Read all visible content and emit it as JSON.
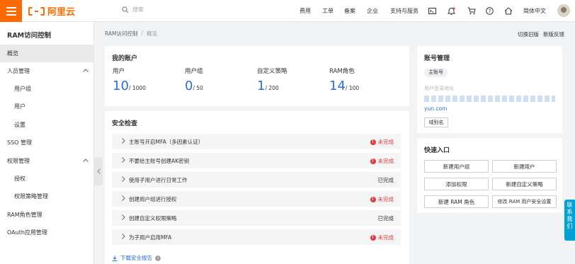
{
  "topbar": {
    "logo_text": "阿里云",
    "search_placeholder": "搜索",
    "nav": [
      "费用",
      "工单",
      "备案",
      "企业",
      "支持与服务"
    ],
    "lang": "简体中文"
  },
  "sidebar": {
    "title": "RAM访问控制",
    "items": [
      {
        "label": "概览"
      },
      {
        "label": "人员管理"
      },
      {
        "label": "用户组"
      },
      {
        "label": "用户"
      },
      {
        "label": "设置"
      },
      {
        "label": "SSO 管理"
      },
      {
        "label": "权限管理"
      },
      {
        "label": "授权"
      },
      {
        "label": "权限策略管理"
      },
      {
        "label": "RAM角色管理"
      },
      {
        "label": "OAuth应用管理"
      }
    ]
  },
  "breadcrumb": {
    "root": "RAM访问控制",
    "sep": "/",
    "current": "概览"
  },
  "header_links": {
    "old_version": "切换旧版",
    "feedback": "新版反馈"
  },
  "account": {
    "title": "我的账户",
    "stats": [
      {
        "label": "用户",
        "value": "10",
        "limit": "/ 1000"
      },
      {
        "label": "用户组",
        "value": "0",
        "limit": "/ 50"
      },
      {
        "label": "自定义策略",
        "value": "1",
        "limit": "/ 200"
      },
      {
        "label": "RAM角色",
        "value": "14",
        "limit": "/ 100"
      }
    ]
  },
  "security": {
    "title": "安全检查",
    "rows": [
      {
        "text": "主账号开启MFA（多因素认证）",
        "status": "未完成",
        "done": false
      },
      {
        "text": "不要给主账号创建AK密钥",
        "status": "未完成",
        "done": false
      },
      {
        "text": "使用子用户进行日常工作",
        "status": "已完成",
        "done": true
      },
      {
        "text": "创建用户组进行授权",
        "status": "未完成",
        "done": false
      },
      {
        "text": "创建自定义权限策略",
        "status": "已完成",
        "done": true
      },
      {
        "text": "为子用户启用MFA",
        "status": "未完成",
        "done": false
      }
    ],
    "download": "下载安全报告"
  },
  "account_mgmt": {
    "title": "账号管理",
    "badge": "主账号",
    "login_label": "用户登录地址",
    "login_prefix": "yun.com",
    "alias_btn": "域别名"
  },
  "quick": {
    "title": "快速入口",
    "buttons": [
      "新建用户组",
      "新建用户",
      "添加权限",
      "新建自定义策略",
      "新建 RAM 角色",
      "修改 RAM 用户安全设置"
    ]
  },
  "float_contact": "联系我们",
  "colors": {
    "brand": "#ff6a00",
    "link": "#2a6fdb",
    "error": "#e5393a"
  }
}
